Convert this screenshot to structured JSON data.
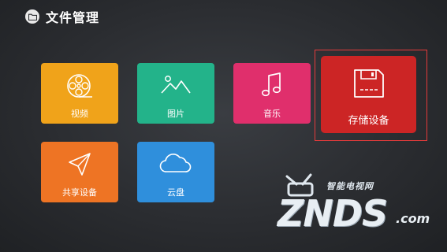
{
  "header": {
    "title": "文件管理",
    "icon": "folder-icon"
  },
  "tiles": {
    "video": {
      "label": "视频",
      "icon": "film-reel-icon",
      "color": "#f0a31a"
    },
    "image": {
      "label": "图片",
      "icon": "mountain-image-icon",
      "color": "#23b38a"
    },
    "music": {
      "label": "音乐",
      "icon": "music-note-icon",
      "color": "#e02f6c"
    },
    "storage": {
      "label": "存储设备",
      "icon": "floppy-disk-icon",
      "color": "#cc2525",
      "focused": true
    },
    "share": {
      "label": "共享设备",
      "icon": "send-arrow-icon",
      "color": "#ee7424"
    },
    "cloud": {
      "label": "云盘",
      "icon": "cloud-icon",
      "color": "#2f8fdc"
    }
  },
  "watermark": {
    "top": "智能电视网",
    "main": "ZNDS",
    "sub": ".com"
  }
}
